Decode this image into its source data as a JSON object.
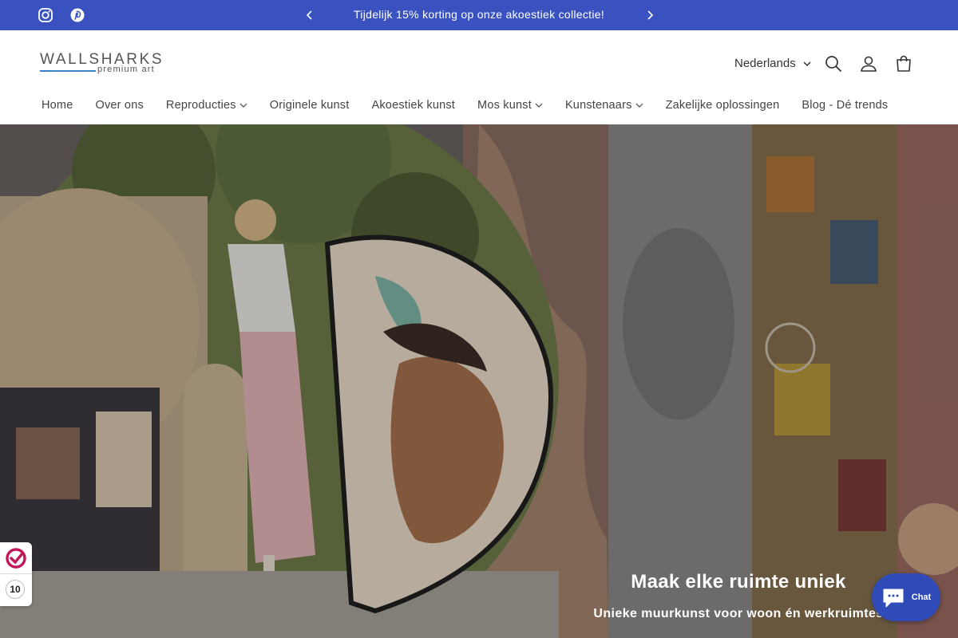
{
  "announcement": {
    "message": "Tijdelijk 15% korting op onze akoestiek collectie!",
    "social": [
      "instagram-icon",
      "pinterest-icon"
    ]
  },
  "header": {
    "logo": {
      "wordmark": "WALLSHARKS",
      "tagline": "premium art"
    },
    "language": "Nederlands",
    "icons": [
      "search-icon",
      "account-icon",
      "cart-icon"
    ]
  },
  "nav": {
    "items": [
      {
        "label": "Home",
        "dropdown": false
      },
      {
        "label": "Over ons",
        "dropdown": false
      },
      {
        "label": "Reproducties",
        "dropdown": true
      },
      {
        "label": "Originele kunst",
        "dropdown": false
      },
      {
        "label": "Akoestiek kunst",
        "dropdown": false
      },
      {
        "label": "Mos kunst",
        "dropdown": true
      },
      {
        "label": "Kunstenaars",
        "dropdown": true
      },
      {
        "label": "Zakelijke oplossingen",
        "dropdown": false
      },
      {
        "label": "Blog - Dé trends",
        "dropdown": false
      }
    ]
  },
  "hero": {
    "title": "Maak elke ruimte uniek",
    "subtitle": "Unieke muurkunst voor woon én werkruimtes"
  },
  "review_badge": {
    "score": "10"
  },
  "chat": {
    "label": "Chat"
  },
  "colors": {
    "accent": "#3a52c0",
    "chat": "#2e4bb8",
    "logo_line": "#3a82c8"
  }
}
